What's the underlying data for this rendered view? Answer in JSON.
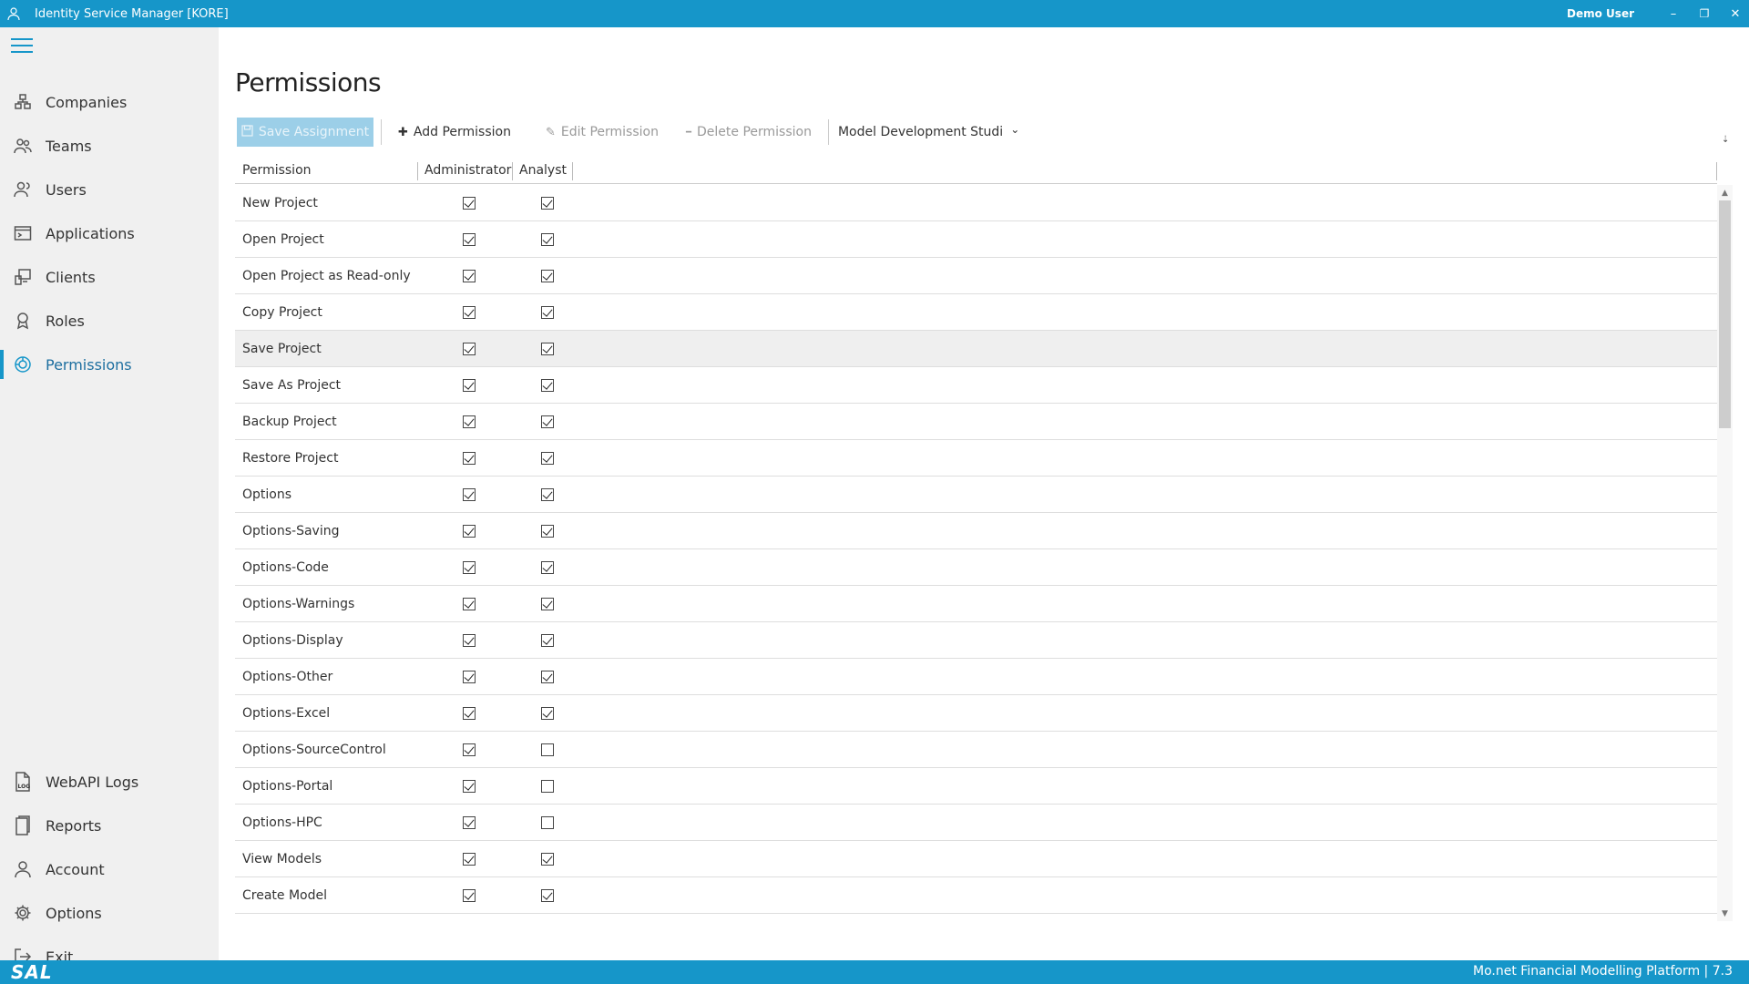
{
  "window": {
    "title": "Identity Service Manager [KORE]",
    "user": "Demo User",
    "minimize_glyph": "–",
    "restore_glyph": "❐",
    "close_glyph": "✕"
  },
  "sidebar": {
    "items": [
      {
        "label": "Companies",
        "icon": "companies-icon"
      },
      {
        "label": "Teams",
        "icon": "teams-icon"
      },
      {
        "label": "Users",
        "icon": "users-icon"
      },
      {
        "label": "Applications",
        "icon": "applications-icon"
      },
      {
        "label": "Clients",
        "icon": "clients-icon"
      },
      {
        "label": "Roles",
        "icon": "roles-icon"
      },
      {
        "label": "Permissions",
        "icon": "permissions-icon",
        "active": true
      }
    ],
    "bottom_items": [
      {
        "label": "WebAPI Logs",
        "icon": "log-icon"
      },
      {
        "label": "Reports",
        "icon": "reports-icon"
      },
      {
        "label": "Account",
        "icon": "account-icon"
      },
      {
        "label": "Options",
        "icon": "gear-icon"
      },
      {
        "label": "Exit",
        "icon": "exit-icon"
      }
    ]
  },
  "page": {
    "title": "Permissions"
  },
  "toolbar": {
    "save_assignment": "Save Assignment",
    "add_permission": "Add Permission",
    "edit_permission": "Edit Permission",
    "delete_permission": "Delete Permission",
    "application_select": "Model Development Studi",
    "add_glyph": "✚",
    "edit_glyph": "✎",
    "delete_glyph": "━",
    "dropdown_glyph": "⌄",
    "overflow_glyph": "⇣"
  },
  "grid": {
    "columns": [
      "Permission",
      "Administrator",
      "Analyst"
    ],
    "rows": [
      {
        "name": "New Project",
        "administrator": true,
        "analyst": true
      },
      {
        "name": "Open Project",
        "administrator": true,
        "analyst": true
      },
      {
        "name": "Open Project as Read-only",
        "administrator": true,
        "analyst": true
      },
      {
        "name": "Copy Project",
        "administrator": true,
        "analyst": true
      },
      {
        "name": "Save Project",
        "administrator": true,
        "analyst": true
      },
      {
        "name": "Save As Project",
        "administrator": true,
        "analyst": true
      },
      {
        "name": "Backup Project",
        "administrator": true,
        "analyst": true
      },
      {
        "name": "Restore Project",
        "administrator": true,
        "analyst": true
      },
      {
        "name": "Options",
        "administrator": true,
        "analyst": true
      },
      {
        "name": "Options-Saving",
        "administrator": true,
        "analyst": true
      },
      {
        "name": "Options-Code",
        "administrator": true,
        "analyst": true
      },
      {
        "name": "Options-Warnings",
        "administrator": true,
        "analyst": true
      },
      {
        "name": "Options-Display",
        "administrator": true,
        "analyst": true
      },
      {
        "name": "Options-Other",
        "administrator": true,
        "analyst": true
      },
      {
        "name": "Options-Excel",
        "administrator": true,
        "analyst": true
      },
      {
        "name": "Options-SourceControl",
        "administrator": true,
        "analyst": false
      },
      {
        "name": "Options-Portal",
        "administrator": true,
        "analyst": false
      },
      {
        "name": "Options-HPC",
        "administrator": true,
        "analyst": false
      },
      {
        "name": "View Models",
        "administrator": true,
        "analyst": true
      },
      {
        "name": "Create Model",
        "administrator": true,
        "analyst": true
      }
    ],
    "hovered_row": "Save Project"
  },
  "scrollbar": {
    "up_glyph": "▲",
    "down_glyph": "▼"
  },
  "statusbar": {
    "logo": "SAL",
    "product": "Mo.net Financial Modelling Platform | 7.3"
  },
  "colors": {
    "accent": "#1696c9",
    "sidebar_bg": "#f0f0f0",
    "primary_button": "#9ccfe8"
  }
}
